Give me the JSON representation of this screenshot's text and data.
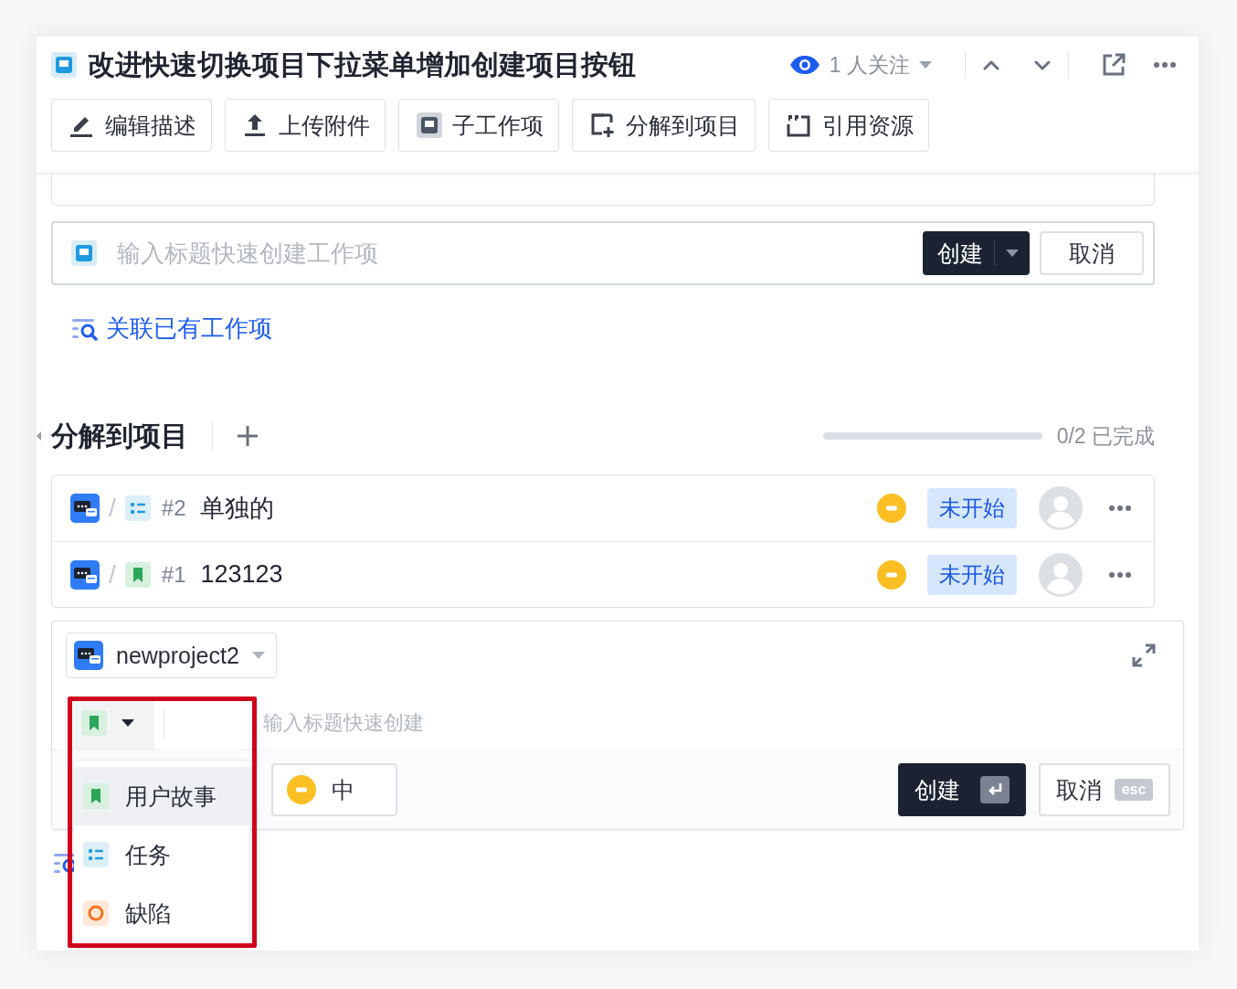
{
  "header": {
    "title": "改进快速切换项目下拉菜单增加创建项目按钮",
    "watchers": "1 人关注",
    "toolbar": [
      {
        "kind": "edit",
        "label": "编辑描述"
      },
      {
        "kind": "upload",
        "label": "上传附件"
      },
      {
        "kind": "subitem",
        "label": "子工作项"
      },
      {
        "kind": "split",
        "label": "分解到项目"
      },
      {
        "kind": "quote",
        "label": "引用资源"
      }
    ]
  },
  "quick_create": {
    "kind": "feature",
    "placeholder": "输入标题快速创建工作项",
    "create": "创建",
    "cancel": "取消"
  },
  "link": "关联已有工作项",
  "section": {
    "title": "分解到项目",
    "progress": {
      "level": 0,
      "reading": "0/2 已完成"
    }
  },
  "items": [
    {
      "kind": "task",
      "separator": "/",
      "number": "#2",
      "title": "单独的",
      "status": "未开始"
    },
    {
      "kind": "story",
      "separator": "/",
      "number": "#1",
      "title": "123123",
      "status": "未开始"
    }
  ],
  "create_panel": {
    "project": "newproject2",
    "kind": "story",
    "placeholder": "输入标题快速创建",
    "priority": "中",
    "create": "创建",
    "cancel": "取消",
    "esc": "esc"
  },
  "type_menu": [
    {
      "kind": "story",
      "label": "用户故事",
      "selected": true
    },
    {
      "kind": "task",
      "label": "任务",
      "selected": false
    },
    {
      "kind": "bug",
      "label": "缺陷",
      "selected": false
    }
  ]
}
